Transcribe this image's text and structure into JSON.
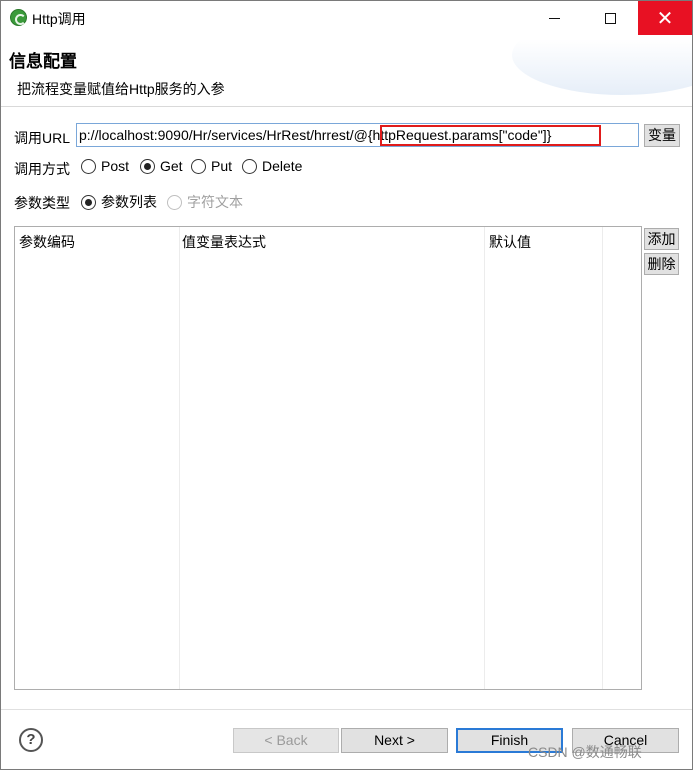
{
  "window": {
    "title": "Http调用",
    "close_glyph": "✕",
    "icon": "app-logo-icon"
  },
  "banner": {
    "title": "信息配置",
    "description": "把流程变量赋值给Http服务的入参"
  },
  "form": {
    "url_label": "调用URL",
    "url_value": "p://localhost:9090/Hr/services/HrRest/hrrest/@{httpRequest.params[\"code\"]}",
    "variable_button": "变量",
    "method_label": "调用方式",
    "methods": [
      {
        "label": "Post",
        "selected": false
      },
      {
        "label": "Get",
        "selected": true
      },
      {
        "label": "Put",
        "selected": false
      },
      {
        "label": "Delete",
        "selected": false
      }
    ],
    "param_type_label": "参数类型",
    "param_types": [
      {
        "label": "参数列表",
        "selected": true,
        "enabled": true
      },
      {
        "label": "字符文本",
        "selected": false,
        "enabled": false
      }
    ]
  },
  "table": {
    "columns": [
      "参数编码",
      "值变量表达式",
      "默认值"
    ],
    "rows": []
  },
  "side_buttons": {
    "add": "添加",
    "delete": "删除"
  },
  "footer": {
    "help": "?",
    "back": "< Back",
    "next": "Next >",
    "finish": "Finish",
    "cancel": "Cancel"
  },
  "watermark": "CSDN @数通畅联",
  "colors": {
    "close_button": "#e81123",
    "url_highlight": "#e01b1b",
    "default_button_border": "#2a7ad6"
  }
}
